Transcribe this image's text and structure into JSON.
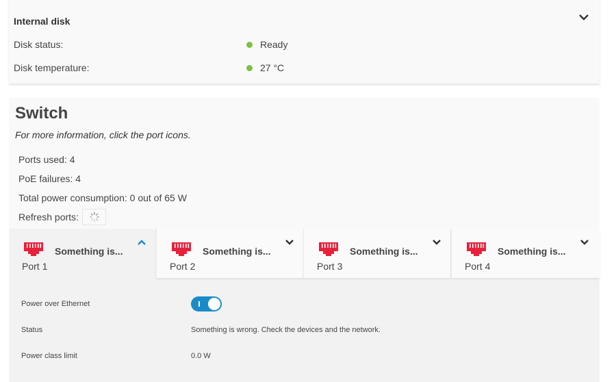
{
  "internal_disk": {
    "title": "Internal disk",
    "expand_icon": "chevron-down-icon",
    "rows": [
      {
        "label": "Disk status:",
        "value": "Ready",
        "status_color": "#7cc142"
      },
      {
        "label": "Disk temperature:",
        "value": "27 °C",
        "status_color": "#7cc142"
      }
    ]
  },
  "switch": {
    "title": "Switch",
    "hint": "For more information, click the port icons.",
    "stats": {
      "ports_used": "Ports used: 4",
      "poe_failures": "PoE failures: 4",
      "total_power": "Total power consumption: 0 out of 65 W",
      "refresh_label": "Refresh ports:"
    },
    "refresh_icon": "spinner-icon",
    "ports": [
      {
        "label": "Port 1",
        "status": "Something is...",
        "icon": "ethernet-port-icon",
        "expanded": true
      },
      {
        "label": "Port 2",
        "status": "Something is...",
        "icon": "ethernet-port-icon",
        "expanded": false
      },
      {
        "label": "Port 3",
        "status": "Something is...",
        "icon": "ethernet-port-icon",
        "expanded": false
      },
      {
        "label": "Port 4",
        "status": "Something is...",
        "icon": "ethernet-port-icon",
        "expanded": false
      }
    ],
    "port_icon_color": "#e8213b",
    "detail": {
      "poe_label": "Power over Ethernet",
      "poe_enabled": true,
      "status_label": "Status",
      "status_value": "Something is wrong. Check the devices and the network.",
      "power_class_label": "Power class limit",
      "power_class_value": "0.0 W"
    },
    "accent_color": "#1a8bc8"
  }
}
